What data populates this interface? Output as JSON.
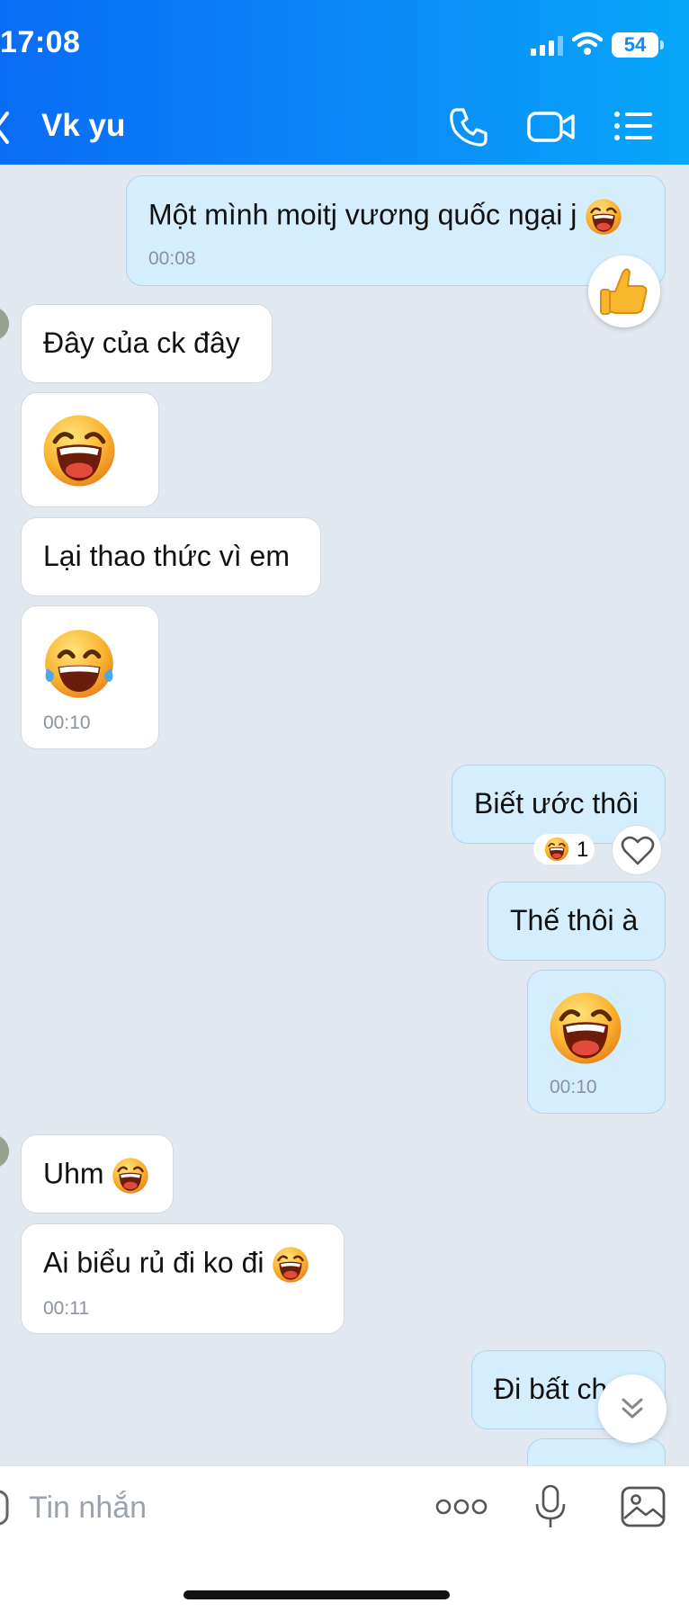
{
  "status_bar": {
    "time": "17:08",
    "battery": "54"
  },
  "header": {
    "contact_name": "Vk yu"
  },
  "messages": [
    {
      "dir": "out",
      "text": "Một mình moitj vương quốc ngại j",
      "time": "00:08"
    },
    {
      "dir": "in",
      "text": "Đây của ck đây"
    },
    {
      "dir": "in",
      "emoji": "laughing-emoji"
    },
    {
      "dir": "in",
      "text": "Lại thao thức vì em"
    },
    {
      "dir": "in",
      "emoji": "tears-of-joy-emoji",
      "time": "00:10"
    },
    {
      "dir": "out",
      "text": "Biết ước thôi",
      "reaction_count": "1"
    },
    {
      "dir": "out",
      "text": "Thế thôi à"
    },
    {
      "dir": "out",
      "emoji": "laughing-emoji",
      "time": "00:10"
    },
    {
      "dir": "in",
      "text": "Uhm"
    },
    {
      "dir": "in",
      "text": "Ai biểu rủ đi ko đi",
      "time": "00:11"
    },
    {
      "dir": "out",
      "text": "Đi bất ch"
    }
  ],
  "composer": {
    "placeholder": "Tin nhắn"
  },
  "icons": {
    "call": "phone-icon",
    "video": "video-camera-icon",
    "menu": "list-menu-icon",
    "like": "thumbs-up-icon",
    "react": "heart-icon",
    "scroll": "chevron-double-down-icon",
    "more": "more-dots-icon",
    "voice": "microphone-icon",
    "image": "image-icon"
  },
  "colors": {
    "header_start": "#0a6cf5",
    "header_end": "#08a6fa",
    "outgoing_bubble": "#d5eefd",
    "incoming_bubble": "#ffffff",
    "chat_background": "#e2e8f0"
  }
}
